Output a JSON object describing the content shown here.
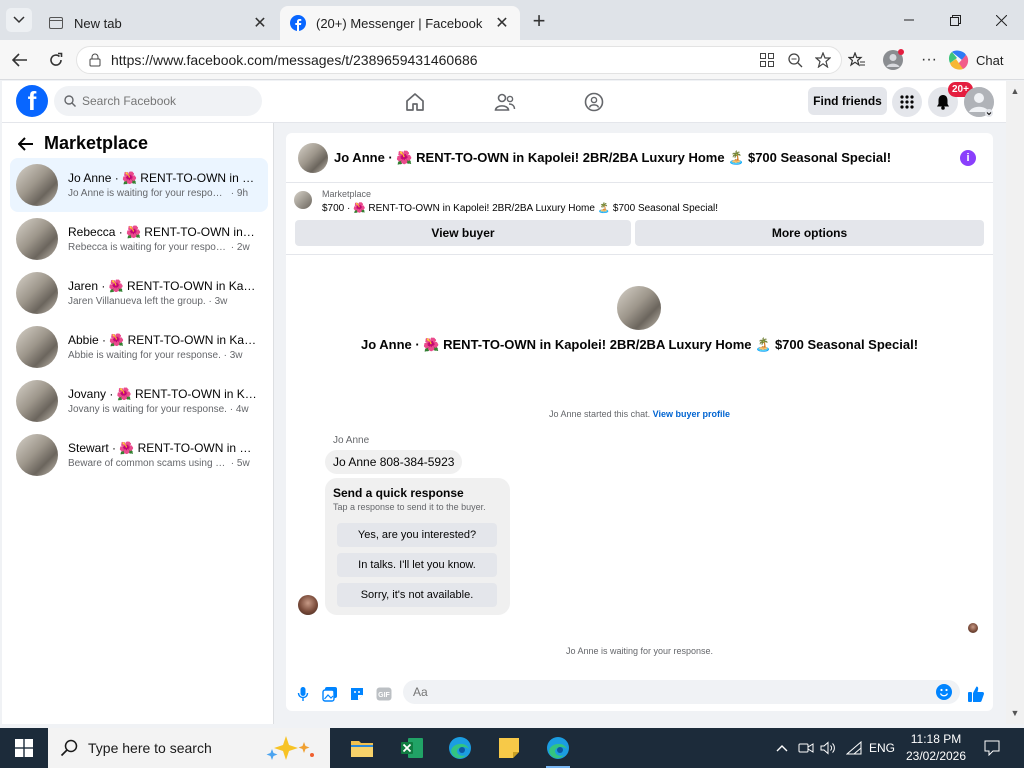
{
  "browser": {
    "tabs": [
      {
        "label": "New tab",
        "active": false
      },
      {
        "label": "(20+) Messenger | Facebook",
        "active": true
      }
    ],
    "url": "https://www.facebook.com/messages/t/2389659431460686",
    "chat_label": "Chat"
  },
  "fb_header": {
    "search_placeholder": "Search Facebook",
    "find_friends": "Find friends",
    "notification_count": "20+",
    "brand_color": "#0866ff"
  },
  "sidebar": {
    "title": "Marketplace",
    "conversations": [
      {
        "title": "Jo Anne · 🌺 RENT-TO-OWN in Ka...",
        "preview": "Jo Anne is waiting for your response.",
        "time": "· 9h",
        "selected": true
      },
      {
        "title": "Rebecca · 🌺 RENT-TO-OWN in Ka...",
        "preview": "Rebecca is waiting for your response.",
        "time": "· 2w"
      },
      {
        "title": "Jaren · 🌺 RENT-TO-OWN in Kapol...",
        "preview": "Jaren Villanueva left the group.",
        "time": "· 3w"
      },
      {
        "title": "Abbie · 🌺 RENT-TO-OWN in Kapo...",
        "preview": "Abbie is waiting for your response.",
        "time": "· 3w"
      },
      {
        "title": "Jovany · 🌺 RENT-TO-OWN in Kap...",
        "preview": "Jovany is waiting for your response.",
        "time": "· 4w"
      },
      {
        "title": "Stewart · 🌺 RENT-TO-OWN in Ka...",
        "preview": "Beware of common scams using pay...",
        "time": "· 5w"
      }
    ]
  },
  "chat": {
    "header_title": "Jo Anne · 🌺 RENT-TO-OWN in Kapolei! 2BR/2BA Luxury Home 🏝️ $700 Seasonal Special!",
    "marketplace_label": "Marketplace",
    "listing_line": "$700 · 🌺 RENT-TO-OWN in Kapolei! 2BR/2BA Luxury Home 🏝️ $700 Seasonal Special!",
    "view_buyer": "View buyer",
    "more_options": "More options",
    "intro_title": "Jo Anne · 🌺 RENT-TO-OWN in Kapolei! 2BR/2BA Luxury Home 🏝️ $700 Seasonal Special!",
    "started_text": "Jo Anne started this chat.",
    "view_buyer_profile": "View buyer profile",
    "sender_name": "Jo Anne",
    "message": "Jo Anne 808-384-5923",
    "quick_response": {
      "title": "Send a quick response",
      "subtitle": "Tap a response to send it to the buyer.",
      "options": [
        "Yes, are you interested?",
        "In talks. I'll let you know.",
        "Sorry, it's not available."
      ]
    },
    "waiting_text": "Jo Anne is waiting for your response.",
    "composer_placeholder": "Aa",
    "accent_color": "#0084ff"
  },
  "taskbar": {
    "search_placeholder": "Type here to search",
    "language": "ENG",
    "time": "11:18 PM",
    "date": "23/02/2026"
  }
}
